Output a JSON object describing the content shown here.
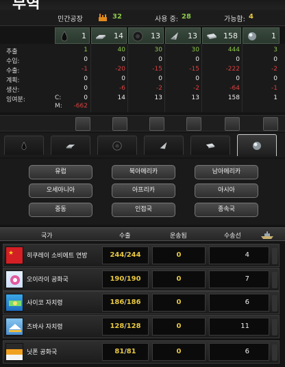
{
  "title": "무역",
  "factory_bar": {
    "civ_label": "민간공장",
    "civ_value": "32",
    "used_label": "사용 중:",
    "used_value": "28",
    "avail_label": "가능함:",
    "avail_value": "4"
  },
  "resources": [
    {
      "name": "oil",
      "icon": "oil-drop-icon",
      "value": "1"
    },
    {
      "name": "aluminium",
      "icon": "aluminium-ingot-icon",
      "value": "14"
    },
    {
      "name": "rubber",
      "icon": "rubber-tire-icon",
      "value": "13"
    },
    {
      "name": "tungsten",
      "icon": "tungsten-shard-icon",
      "value": "13"
    },
    {
      "name": "steel",
      "icon": "steel-bar-icon",
      "value": "158"
    },
    {
      "name": "chromium",
      "icon": "chromium-ball-icon",
      "value": "1"
    }
  ],
  "table": {
    "rows": [
      {
        "label": "추출",
        "m": "",
        "values": [
          "1",
          "40",
          "30",
          "30",
          "444",
          "3"
        ],
        "color": "green"
      },
      {
        "label": "수입:",
        "m": "",
        "values": [
          "0",
          "0",
          "0",
          "0",
          "0",
          "0"
        ],
        "color": "white"
      },
      {
        "label": "수출:",
        "m": "",
        "values": [
          "-1",
          "-20",
          "-15",
          "-15",
          "-222",
          "-2"
        ],
        "color": "red"
      },
      {
        "label": "계획:",
        "m": "",
        "values": [
          "0",
          "0",
          "0",
          "0",
          "0",
          "0"
        ],
        "color": "white"
      },
      {
        "label": "생산:",
        "m": "",
        "values": [
          "0",
          "-6",
          "-2",
          "-2",
          "-64",
          "-1"
        ],
        "color": "red"
      },
      {
        "label": "잉여분:",
        "m": "C:",
        "values": [
          "0",
          "14",
          "13",
          "13",
          "158",
          "1"
        ],
        "color": "white"
      },
      {
        "label": "",
        "m": "M:",
        "values": [
          "-662",
          "",
          "",
          "",
          "",
          ""
        ],
        "color": "red"
      }
    ]
  },
  "strip_buttons": [
    "trade-button-1",
    "trade-button-2",
    "trade-button-3",
    "trade-button-4",
    "trade-button-5",
    "trade-button-6"
  ],
  "tabs": [
    {
      "name": "oil",
      "icon": "oil-drop-icon"
    },
    {
      "name": "aluminium",
      "icon": "aluminium-ingot-icon"
    },
    {
      "name": "rubber",
      "icon": "rubber-tire-icon"
    },
    {
      "name": "tungsten",
      "icon": "tungsten-shard-icon"
    },
    {
      "name": "steel",
      "icon": "steel-bar-icon"
    },
    {
      "name": "chromium",
      "icon": "chromium-ball-icon",
      "active": true
    }
  ],
  "regions": [
    "유럽",
    "북아메리카",
    "남아메리카",
    "오세아니아",
    "아프리카",
    "아시아",
    "중동",
    "인접국",
    "종속국"
  ],
  "list_header": {
    "country": "국가",
    "export": "수출",
    "transport": "운송됨",
    "convoys": "수송선"
  },
  "countries": [
    {
      "name": "히쿠레이 소비에트 연방",
      "flag": "flag-red",
      "exp_current": "244",
      "exp_max": "244",
      "transport": "0",
      "convoys": "4"
    },
    {
      "name": "오이라이 공화국",
      "flag": "flag-pink",
      "exp_current": "190",
      "exp_max": "190",
      "transport": "0",
      "convoys": "7"
    },
    {
      "name": "사이코 자치령",
      "flag": "flag-blue",
      "exp_current": "186",
      "exp_max": "186",
      "transport": "0",
      "convoys": "6"
    },
    {
      "name": "츠바사 자치령",
      "flag": "flag-lightblue",
      "exp_current": "128",
      "exp_max": "128",
      "transport": "0",
      "convoys": "11"
    },
    {
      "name": "닛폰 공화국",
      "flag": "flag-orange",
      "exp_current": "81",
      "exp_max": "81",
      "transport": "0",
      "convoys": "6"
    }
  ],
  "colors": {
    "green": "#8cc84b",
    "red": "#e04040",
    "yellow": "#e8c840",
    "panel_green": "#3a4a3e"
  }
}
